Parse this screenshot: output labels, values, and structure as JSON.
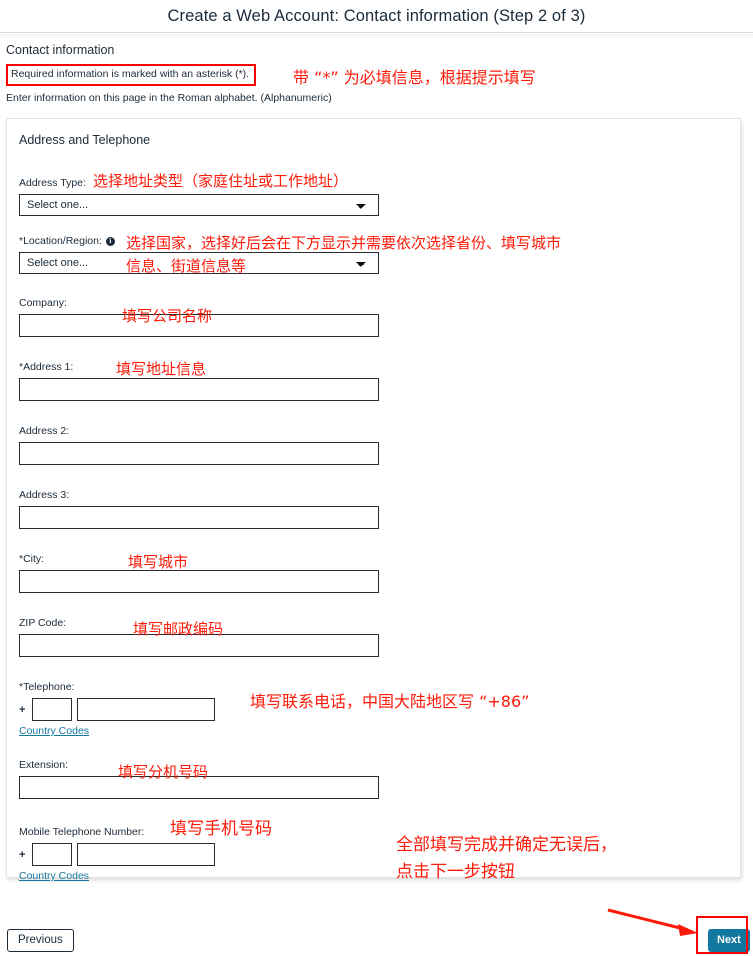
{
  "header": {
    "title": "Create a Web Account: Contact information (Step 2 of 3)"
  },
  "intro": {
    "section_title": "Contact information",
    "required_note": "Required information is marked with an asterisk (*).",
    "roman_note": "Enter information on this page in the Roman alphabet. (Alphanumeric)"
  },
  "card": {
    "title": "Address and Telephone",
    "fields": {
      "address_type": {
        "label": "Address Type:",
        "value": "Select one..."
      },
      "location_region": {
        "label": "*Location/Region:",
        "value": "Select one...",
        "icon": "info-icon"
      },
      "company": {
        "label": "Company:",
        "value": ""
      },
      "address1": {
        "label": "*Address 1:",
        "value": ""
      },
      "address2": {
        "label": "Address 2:",
        "value": ""
      },
      "address3": {
        "label": "Address 3:",
        "value": ""
      },
      "city": {
        "label": "*City:",
        "value": ""
      },
      "zip": {
        "label": "ZIP Code:",
        "value": ""
      },
      "telephone": {
        "label": "*Telephone:",
        "plus": "+",
        "country_code": "",
        "number": "",
        "link": "Country Codes"
      },
      "extension": {
        "label": "Extension:",
        "value": ""
      },
      "mobile": {
        "label": "Mobile Telephone Number:",
        "plus": "+",
        "country_code": "",
        "number": "",
        "link": "Country Codes"
      }
    }
  },
  "footer": {
    "previous_label": "Previous",
    "next_label": "Next"
  },
  "annotations": {
    "color": "#fd1a08",
    "required": "带 “*” 为必填信息，根据提示填写",
    "address_type": "选择地址类型（家庭住址或工作地址）",
    "location_region": "选择国家，选择好后会在下方显示并需要依次选择省份、填写城市\n信息、街道信息等",
    "company": "填写公司名称",
    "address1": "填写地址信息",
    "city": "填写城市",
    "zip": "填写邮政编码",
    "telephone": "填写联系电话，中国大陆地区写 “+86”",
    "extension": "填写分机号码",
    "mobile": "填写手机号码",
    "next": "全部填写完成并确定无误后，\n点击下一步按钮"
  }
}
